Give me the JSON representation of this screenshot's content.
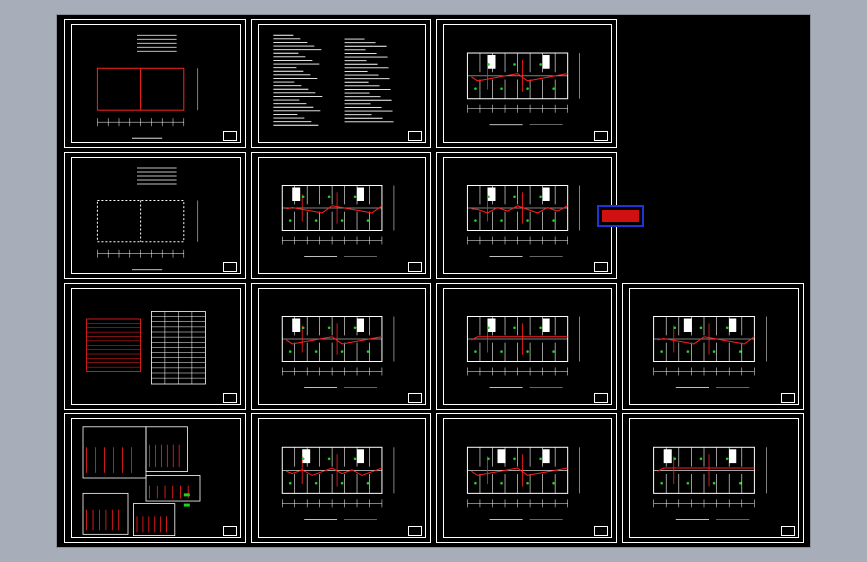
{
  "colors": {
    "background": "#a7aeb9",
    "canvas": "#000000",
    "linework": "#ffffff",
    "wiring": "#ff2020",
    "equipment": "#21d021",
    "stamp_border": "#2032d8",
    "stamp_fill": "#d11111"
  },
  "sheets": [
    {
      "id": "r1c1",
      "kind": "site-outline",
      "title": ""
    },
    {
      "id": "r1c2",
      "kind": "notes",
      "title": ""
    },
    {
      "id": "r1c3",
      "kind": "floor-plan",
      "title": ""
    },
    {
      "id": "r2c1",
      "kind": "site-outline-dashed",
      "title": ""
    },
    {
      "id": "r2c2",
      "kind": "floor-plan",
      "title": ""
    },
    {
      "id": "r2c3",
      "kind": "floor-plan",
      "title": ""
    },
    {
      "id": "r3c1",
      "kind": "tables",
      "title": ""
    },
    {
      "id": "r3c2",
      "kind": "floor-plan",
      "title": ""
    },
    {
      "id": "r3c3",
      "kind": "floor-plan",
      "title": ""
    },
    {
      "id": "r3c4",
      "kind": "floor-plan",
      "title": ""
    },
    {
      "id": "r4c1",
      "kind": "schematic",
      "title": ""
    },
    {
      "id": "r4c2",
      "kind": "floor-plan",
      "title": ""
    },
    {
      "id": "r4c3",
      "kind": "floor-plan",
      "title": ""
    },
    {
      "id": "r4c4",
      "kind": "floor-plan",
      "title": ""
    }
  ],
  "stamp": {
    "kind": "red-stamp-block"
  }
}
